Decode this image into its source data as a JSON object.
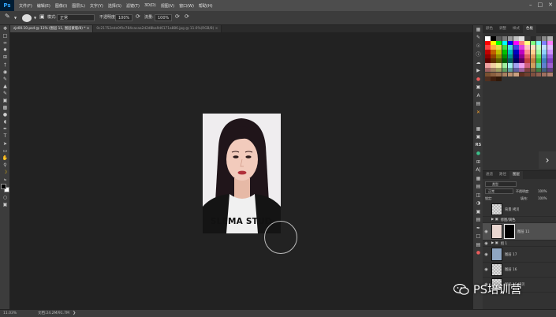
{
  "menubar": {
    "logo": "Ps",
    "items": [
      "文件(F)",
      "编辑(E)",
      "图像(I)",
      "图层(L)",
      "文字(Y)",
      "选择(S)",
      "滤镜(T)",
      "3D(D)",
      "视图(V)",
      "窗口(W)",
      "帮助(H)"
    ]
  },
  "options": {
    "mode_label": "模式:",
    "mode_value": "正常",
    "opacity_label": "不透明度:",
    "opacity_value": "100%",
    "flow_label": "流量:",
    "flow_value": "100%"
  },
  "tabs": [
    {
      "label": "zjz00.10.psd @ 11% (图层 11, 图层蒙版/8) * ×",
      "active": true
    },
    {
      "label": "0c21752ede0f0e784cacaa2d2d8ba9d6171a886.jpg @ 11.6%(RGB/8) ×",
      "active": false
    }
  ],
  "canvas": {
    "shirt_text": "SLEMA STUD"
  },
  "status": {
    "zoom": "11.03%",
    "doc_size": "文档:24.2M/91.7M"
  },
  "panels": {
    "top_tabs": [
      "颜色",
      "调整",
      "样式",
      "色板"
    ],
    "layer_tabs": [
      "图层",
      "通道",
      "路径"
    ],
    "filter_label": "类型",
    "blend_mode": "正常",
    "opacity_label": "不透明度:",
    "opacity_value": "100%",
    "lock_label": "锁定:",
    "fill_label": "填充:",
    "fill_value": "100%",
    "layers": [
      {
        "name": "背景 拷贝"
      },
      {
        "name": "修图/调色"
      },
      {
        "name": "图层 11"
      },
      {
        "name": "组 1"
      },
      {
        "name": "图层 17"
      },
      {
        "name": "图层 16"
      },
      {
        "name": "图层 15 拷贝"
      }
    ]
  },
  "watermark": "PS培训营",
  "colors": {
    "menubar": "#4d4d4d",
    "panel": "#323232",
    "canvas": "#222222",
    "ps_blue": "#31a8ff"
  }
}
